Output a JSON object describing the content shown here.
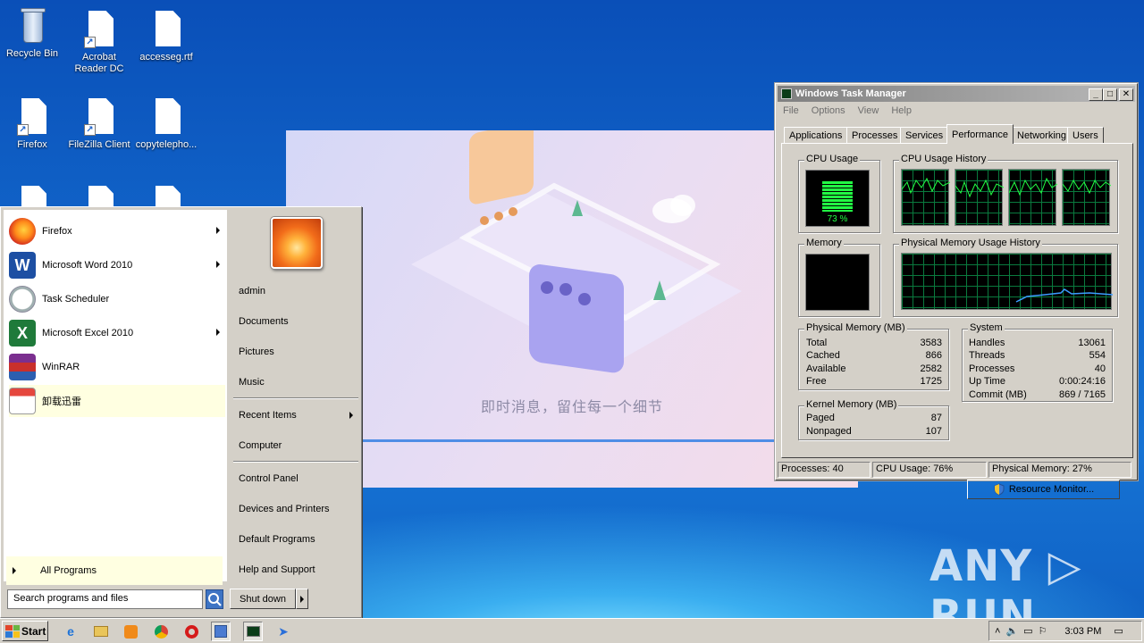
{
  "desktop": {
    "icons": [
      {
        "label": "Recycle Bin",
        "icon": "recycle-bin-icon"
      },
      {
        "label": "Acrobat Reader DC",
        "icon": "acrobat-shortcut-icon"
      },
      {
        "label": "accesseg.rtf",
        "icon": "document-icon"
      },
      {
        "label": "Firefox",
        "icon": "firefox-shortcut-icon"
      },
      {
        "label": "FileZilla Client",
        "icon": "filezilla-shortcut-icon"
      },
      {
        "label": "copytelepho...",
        "icon": "document-icon"
      }
    ],
    "watermark": "ANY ▷ RUN"
  },
  "splash": {
    "message": "即时消息，留住每一个细节",
    "colors": {
      "accent": "#4f8ee6",
      "bubble_orange": "#f7c89a",
      "bubble_purple": "#a9a3f0"
    }
  },
  "start_menu": {
    "programs": [
      {
        "label": "Firefox",
        "icon": "firefox-icon",
        "submenu": true
      },
      {
        "label": "Microsoft Word 2010",
        "icon": "word-icon",
        "submenu": true
      },
      {
        "label": "Task Scheduler",
        "icon": "clock-icon",
        "submenu": false
      },
      {
        "label": "Microsoft Excel 2010",
        "icon": "excel-icon",
        "submenu": true
      },
      {
        "label": "WinRAR",
        "icon": "winrar-icon",
        "submenu": false
      },
      {
        "label": "卸载迅雷",
        "icon": "uninstall-icon",
        "submenu": false,
        "highlighted": true
      }
    ],
    "all_programs": "All Programs",
    "search_placeholder": "Search programs and files",
    "right_items": [
      "admin",
      "Documents",
      "Pictures",
      "Music",
      "Recent Items",
      "Computer",
      "Control Panel",
      "Devices and Printers",
      "Default Programs",
      "Help and Support"
    ],
    "shutdown": "Shut down"
  },
  "task_manager": {
    "title": "Windows Task Manager",
    "menu": [
      "File",
      "Options",
      "View",
      "Help"
    ],
    "tabs": [
      "Applications",
      "Processes",
      "Services",
      "Performance",
      "Networking",
      "Users"
    ],
    "active_tab": "Performance",
    "cpu_usage_label": "CPU Usage",
    "cpu_usage_value": "73 %",
    "cpu_usage_fraction": 0.73,
    "cpu_history_label": "CPU Usage History",
    "memory_label": "Memory",
    "memory_history_label": "Physical Memory Usage History",
    "physical_memory": {
      "label": "Physical Memory (MB)",
      "rows": [
        {
          "k": "Total",
          "v": "3583"
        },
        {
          "k": "Cached",
          "v": "866"
        },
        {
          "k": "Available",
          "v": "2582"
        },
        {
          "k": "Free",
          "v": "1725"
        }
      ]
    },
    "kernel_memory": {
      "label": "Kernel Memory (MB)",
      "rows": [
        {
          "k": "Paged",
          "v": "87"
        },
        {
          "k": "Nonpaged",
          "v": "107"
        }
      ]
    },
    "system": {
      "label": "System",
      "rows": [
        {
          "k": "Handles",
          "v": "13061"
        },
        {
          "k": "Threads",
          "v": "554"
        },
        {
          "k": "Processes",
          "v": "40"
        },
        {
          "k": "Up Time",
          "v": "0:00:24:16"
        },
        {
          "k": "Commit (MB)",
          "v": "869 / 7165"
        }
      ]
    },
    "resource_monitor": "Resource Monitor...",
    "status": {
      "processes": "Processes: 40",
      "cpu": "CPU Usage: 76%",
      "memory": "Physical Memory: 27%"
    }
  },
  "taskbar": {
    "start": "Start",
    "icons": [
      "ie-icon",
      "explorer-icon",
      "media-player-icon",
      "chrome-icon",
      "opera-icon",
      "installer-icon",
      "task-manager-icon",
      "xunlei-icon"
    ],
    "clock": "3:03 PM"
  }
}
